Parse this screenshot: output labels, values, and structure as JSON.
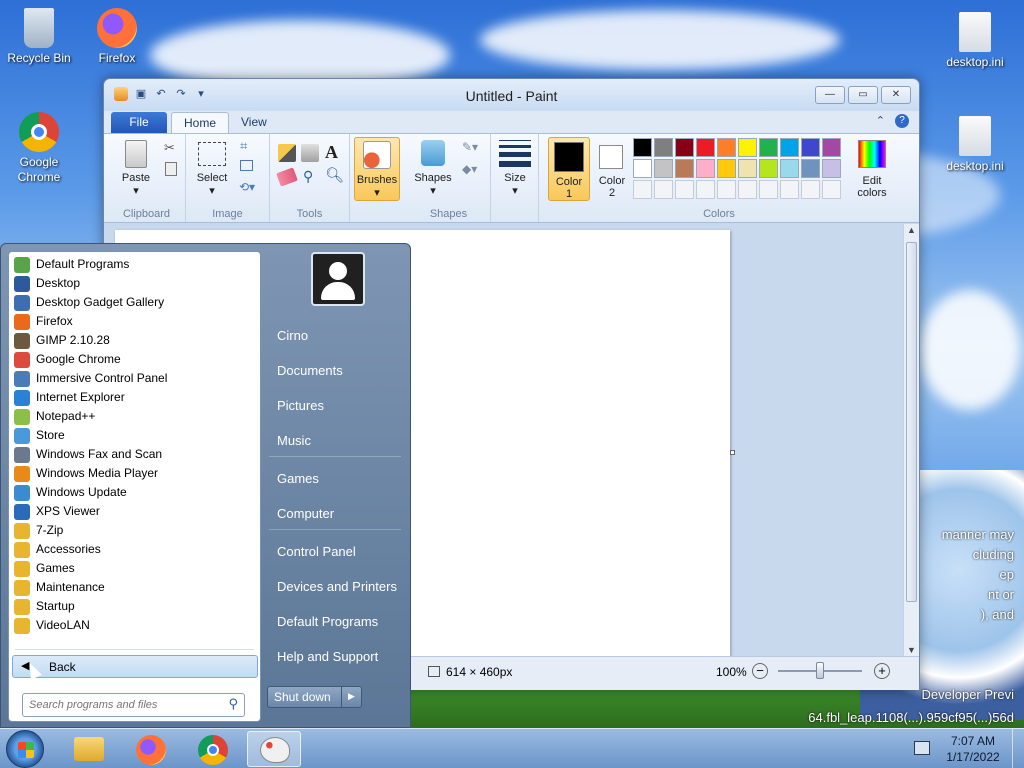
{
  "desktop": {
    "icons": [
      {
        "label": "Recycle Bin"
      },
      {
        "label": "Firefox"
      },
      {
        "label": "Google Chrome"
      },
      {
        "label": "desktop.ini"
      },
      {
        "label": "desktop.ini"
      }
    ],
    "watermark": [
      "manner may",
      "cluding",
      "ep",
      "nt or",
      "), and",
      "Developer Previ",
      "64.fbl_leap.1108(...).959cf95(...)56d"
    ]
  },
  "paint": {
    "title": "Untitled - Paint",
    "quick_access": [
      "save-icon",
      "undo-icon",
      "redo-icon",
      "customize-icon"
    ],
    "window_buttons": [
      "minimize",
      "maximize",
      "close"
    ],
    "tabs": {
      "file": "File",
      "home": "Home",
      "view": "View"
    },
    "ribbon": {
      "clipboard": {
        "paste": "Paste",
        "label": "Clipboard"
      },
      "image": {
        "select": "Select",
        "label": "Image"
      },
      "tools": {
        "label": "Tools"
      },
      "brushes": {
        "label": "Brushes"
      },
      "shapes": {
        "shapes": "Shapes",
        "label": "Shapes"
      },
      "size": {
        "label": "Size"
      },
      "colors": {
        "color1": "Color",
        "color1_num": "1",
        "color2": "Color",
        "color2_num": "2",
        "edit1": "Edit",
        "edit2": "colors",
        "label": "Colors",
        "palette_row1": [
          "#000000",
          "#7f7f7f",
          "#880015",
          "#ed1c24",
          "#ff7f27",
          "#fff200",
          "#22b14c",
          "#00a2e8",
          "#3f48cc",
          "#a349a4"
        ],
        "palette_row2": [
          "#ffffff",
          "#c3c3c3",
          "#b97a57",
          "#ffaec9",
          "#ffc90e",
          "#efe4b0",
          "#b5e61d",
          "#99d9ea",
          "#7092be",
          "#c8bfe7"
        ]
      }
    },
    "status": {
      "size": "614 × 460px",
      "zoom": "100%"
    }
  },
  "start_menu": {
    "programs": [
      {
        "label": "Default Programs",
        "color": "#5aa34a"
      },
      {
        "label": "Desktop",
        "color": "#2c5a9c"
      },
      {
        "label": "Desktop Gadget Gallery",
        "color": "#3d6fb0"
      },
      {
        "label": "Firefox",
        "color": "#e86a1a"
      },
      {
        "label": "GIMP 2.10.28",
        "color": "#6b5a3e"
      },
      {
        "label": "Google Chrome",
        "color": "#dd4b3e"
      },
      {
        "label": "Immersive Control Panel",
        "color": "#4a7cb8"
      },
      {
        "label": "Internet Explorer",
        "color": "#2a82d4"
      },
      {
        "label": "Notepad++",
        "color": "#8bbf4a"
      },
      {
        "label": "Store",
        "color": "#4a9adb"
      },
      {
        "label": "Windows Fax and Scan",
        "color": "#6a7a8c"
      },
      {
        "label": "Windows Media Player",
        "color": "#e88a1a"
      },
      {
        "label": "Windows Update",
        "color": "#3c8ad0"
      },
      {
        "label": "XPS Viewer",
        "color": "#2a6ab8"
      },
      {
        "label": "7-Zip",
        "color": "#e8b530"
      },
      {
        "label": "Accessories",
        "color": "#e8b530"
      },
      {
        "label": "Games",
        "color": "#e8b530"
      },
      {
        "label": "Maintenance",
        "color": "#e8b530"
      },
      {
        "label": "Startup",
        "color": "#e8b530"
      },
      {
        "label": "VideoLAN",
        "color": "#e8b530"
      }
    ],
    "back": "Back",
    "search_placeholder": "Search programs and files",
    "right": [
      "Cirno",
      "Documents",
      "Pictures",
      "Music",
      "Games",
      "Computer",
      "Control Panel",
      "Devices and Printers",
      "Default Programs",
      "Help and Support"
    ],
    "shutdown": "Shut down"
  },
  "taskbar": {
    "time": "7:07 AM",
    "date": "1/17/2022"
  }
}
